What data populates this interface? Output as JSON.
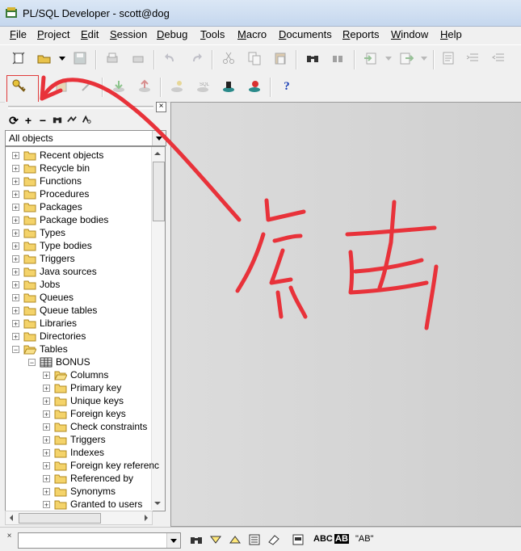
{
  "window": {
    "title": "PL/SQL Developer - scott@dog"
  },
  "menu": [
    {
      "label": "File",
      "u": "F",
      "rest": "ile"
    },
    {
      "label": "Project",
      "u": "P",
      "rest": "roject"
    },
    {
      "label": "Edit",
      "u": "E",
      "rest": "dit"
    },
    {
      "label": "Session",
      "u": "S",
      "rest": "ession"
    },
    {
      "label": "Debug",
      "u": "D",
      "rest": "ebug"
    },
    {
      "label": "Tools",
      "u": "T",
      "rest": "ools"
    },
    {
      "label": "Macro",
      "u": "M",
      "rest": "acro"
    },
    {
      "label": "Documents",
      "u": "D",
      "rest": "ocuments"
    },
    {
      "label": "Reports",
      "u": "R",
      "rest": "eports"
    },
    {
      "label": "Window",
      "u": "W",
      "rest": "indow"
    },
    {
      "label": "Help",
      "u": "H",
      "rest": "elp"
    }
  ],
  "toolbar1": {
    "icons": [
      "new-icon",
      "open-icon",
      "save-icon",
      "print-icon",
      "print-preview-icon",
      "undo-icon",
      "redo-icon",
      "cut-icon",
      "copy-icon",
      "paste-icon",
      "find-icon",
      "replace-icon",
      "import-icon",
      "export-icon",
      "properties-icon",
      "indent-icon",
      "unindent-icon"
    ]
  },
  "toolbar2": {
    "icons": [
      "logon-key-icon",
      "commit-icon",
      "rollback-icon",
      "compile-icon",
      "execute-icon",
      "explain-icon",
      "sql-icon",
      "break-icon",
      "stop-icon"
    ],
    "help_label": "?"
  },
  "object_browser": {
    "filter_value": "All objects",
    "tools": [
      "refresh-icon",
      "add-icon",
      "remove-icon",
      "find-icon",
      "filter-icon",
      "sort-icon"
    ],
    "items": [
      {
        "label": "Recent objects"
      },
      {
        "label": "Recycle bin"
      },
      {
        "label": "Functions"
      },
      {
        "label": "Procedures"
      },
      {
        "label": "Packages"
      },
      {
        "label": "Package bodies"
      },
      {
        "label": "Types"
      },
      {
        "label": "Type bodies"
      },
      {
        "label": "Triggers"
      },
      {
        "label": "Java sources"
      },
      {
        "label": "Jobs"
      },
      {
        "label": "Queues"
      },
      {
        "label": "Queue tables"
      },
      {
        "label": "Libraries"
      },
      {
        "label": "Directories"
      },
      {
        "label": "Tables"
      }
    ],
    "table_node": {
      "label": "BONUS"
    },
    "table_children": [
      {
        "label": "Columns"
      },
      {
        "label": "Primary key"
      },
      {
        "label": "Unique keys"
      },
      {
        "label": "Foreign keys"
      },
      {
        "label": "Check constraints"
      },
      {
        "label": "Triggers"
      },
      {
        "label": "Indexes"
      },
      {
        "label": "Foreign key referenc"
      },
      {
        "label": "Referenced by"
      },
      {
        "label": "Synonyms"
      },
      {
        "label": "Granted to users"
      }
    ]
  },
  "find_bar": {
    "value": "",
    "buttons": [
      "ABC",
      "AB",
      "\"AB\""
    ]
  },
  "colors": {
    "annotation": "#e8323a",
    "highlight": "#e03b3b"
  }
}
